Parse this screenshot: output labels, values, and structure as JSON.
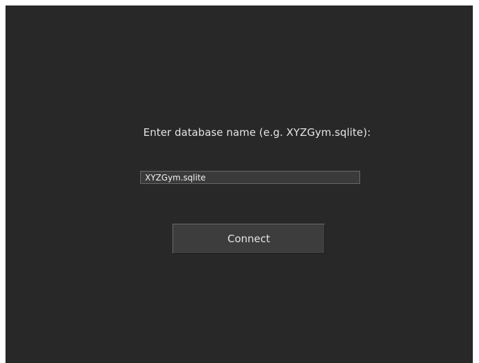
{
  "dialog": {
    "prompt": "Enter database name (e.g. XYZGym.sqlite):",
    "input_value": "XYZGym.sqlite",
    "connect_label": "Connect"
  },
  "colors": {
    "background": "#282828",
    "text": "#e6e6e6",
    "input_background": "#3a3a3a",
    "button_background": "#3d3d3d",
    "border": "#6a6a6a"
  }
}
